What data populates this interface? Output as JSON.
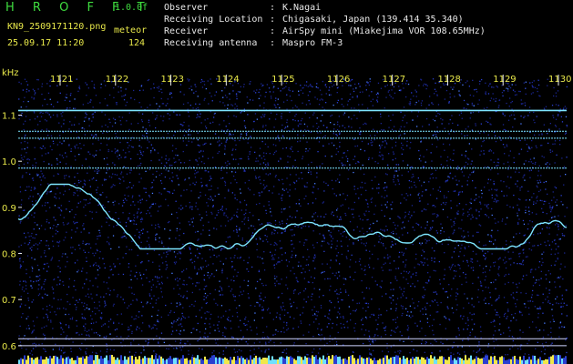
{
  "header": {
    "brand": "H R O F F T",
    "version": "1.0.0f",
    "file_name": "KN9_2509171120.png",
    "mode": "meteor",
    "datetime": "25.09.17 11:20",
    "count": "124",
    "info": [
      {
        "key": "Observer",
        "sep": ":",
        "value": "K.Nagai"
      },
      {
        "key": "Receiving Location",
        "sep": ":",
        "value": "Chigasaki, Japan (139.414 35.340)"
      },
      {
        "key": "Receiver",
        "sep": ":",
        "value": "AirSpy mini (Miakejima VOR 108.65MHz)"
      },
      {
        "key": "Receiving antenna",
        "sep": ":",
        "value": "Maspro FM-3"
      }
    ]
  },
  "spectrogram": {
    "y_unit": "kHz",
    "y_ticks": [
      "1.1",
      "1.0",
      "0.9",
      "0.8",
      "0.7",
      "0.6"
    ],
    "y_tick_values": [
      1.1,
      1.0,
      0.9,
      0.8,
      0.7,
      0.6
    ],
    "y_range": [
      0.58,
      1.18
    ],
    "x_ticks": [
      "1121",
      "1122",
      "1123",
      "1124",
      "1125",
      "1126",
      "1127",
      "1128",
      "1129",
      "1130"
    ],
    "horizontal_lines_khz": [
      1.11,
      1.065,
      1.05,
      0.985,
      0.615,
      0.6
    ],
    "colors": {
      "background": "#000000",
      "noise": "#1f2fa8",
      "trace": "#7ee6ff",
      "label": "#e8e84a",
      "tick": "#e8e8e8"
    }
  }
}
